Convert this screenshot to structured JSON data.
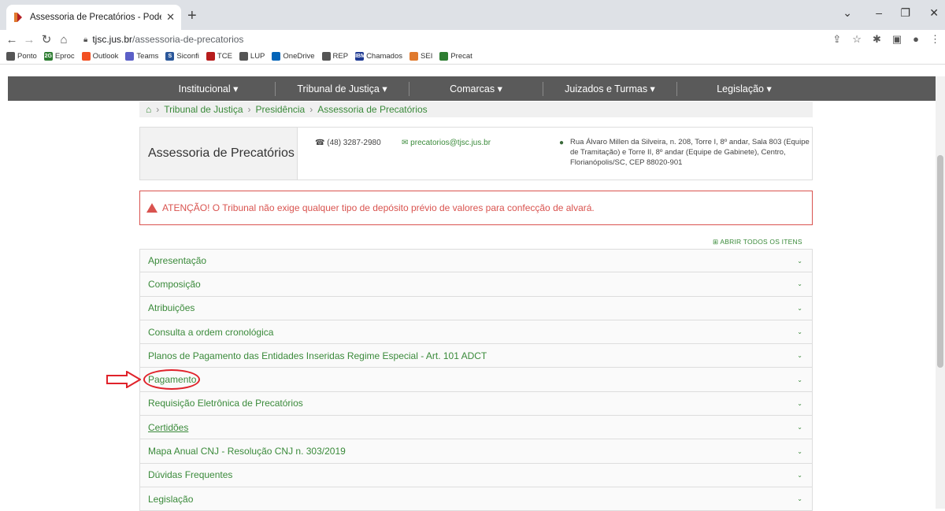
{
  "browser": {
    "tab_title": "Assessoria de Precatórios - Pode",
    "url_host": "tjsc.jus.br",
    "url_path": "/assessoria-de-precatorios",
    "bookmarks": [
      {
        "label": "Ponto",
        "color": "#555555",
        "glyph": ""
      },
      {
        "label": "Eproc",
        "color": "#2e7d32",
        "glyph": "2G"
      },
      {
        "label": "Outlook",
        "color": "#f25022",
        "glyph": ""
      },
      {
        "label": "Teams",
        "color": "#5b5fc7",
        "glyph": ""
      },
      {
        "label": "Siconfi",
        "color": "#2b579a",
        "glyph": "S"
      },
      {
        "label": "TCE",
        "color": "#b71c1c",
        "glyph": ""
      },
      {
        "label": "LUP",
        "color": "#555555",
        "glyph": ""
      },
      {
        "label": "OneDrive",
        "color": "#0364b8",
        "glyph": ""
      },
      {
        "label": "REP",
        "color": "#555555",
        "glyph": ""
      },
      {
        "label": "Chamados",
        "color": "#1f3a93",
        "glyph": "IBM"
      },
      {
        "label": "SEI",
        "color": "#e07a2e",
        "glyph": ""
      },
      {
        "label": "Precat",
        "color": "#2e7d32",
        "glyph": ""
      }
    ]
  },
  "nav": {
    "items": [
      "Institucional ▾",
      "Tribunal de Justiça ▾",
      "Comarcas ▾",
      "Juizados e Turmas ▾",
      "Legislação ▾"
    ]
  },
  "breadcrumb": {
    "home": "⌂",
    "items": [
      "Tribunal de Justiça",
      "Presidência",
      "Assessoria de Precatórios"
    ]
  },
  "info": {
    "title": "Assessoria de Precatórios",
    "phone": "(48) 3287-2980",
    "email": "precatorios@tjsc.jus.br",
    "address": "Rua Álvaro Millen da Silveira, n. 208, Torre I, 8º andar, Sala 803 (Equipe de Tramitação) e Torre II, 8º andar (Equipe de Gabinete), Centro, Florianópolis/SC, CEP 88020-901"
  },
  "alert": {
    "text": "ATENÇÃO! O Tribunal não exige qualquer tipo de depósito prévio de valores para confecção de alvará.",
    "color": "#d9534f"
  },
  "open_all": "⊞ ABRIR TODOS OS ITENS",
  "accordion": [
    {
      "label": "Apresentação"
    },
    {
      "label": "Composição"
    },
    {
      "label": "Atribuições"
    },
    {
      "label": "Consulta a ordem cronológica"
    },
    {
      "label": "Planos de Pagamento das Entidades Inseridas Regime Especial - Art. 101 ADCT"
    },
    {
      "label": "Pagamento"
    },
    {
      "label": "Requisição Eletrônica de Precatórios"
    },
    {
      "label": "Certidões"
    },
    {
      "label": "Mapa Anual CNJ - Resolução CNJ n. 303/2019"
    },
    {
      "label": "Dúvidas Frequentes"
    },
    {
      "label": "Legislação"
    }
  ],
  "accent": "#3a8a3a",
  "annotation_color": "#e0222a"
}
